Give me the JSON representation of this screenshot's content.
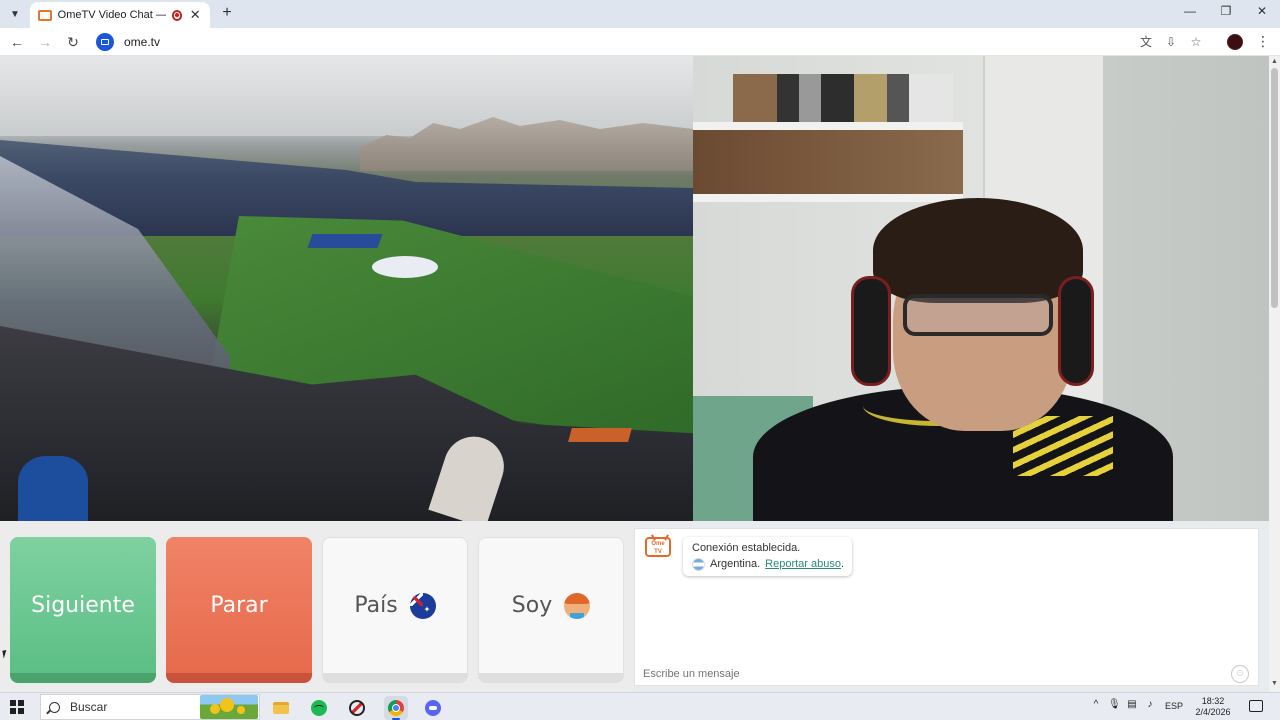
{
  "browser": {
    "tab": {
      "title": "OmeTV Video Chat — Ome",
      "close_glyph": "✕"
    },
    "new_tab_glyph": "+",
    "window_controls": {
      "minimize": "—",
      "maximize": "❐",
      "close": "✕"
    },
    "nav": {
      "back": "←",
      "forward": "→",
      "reload": "↻"
    },
    "url": "ome.tv",
    "toolbar_icons": [
      "translate-icon",
      "install-app-icon",
      "bookmark-star-icon",
      "profile-avatar",
      "menu-icon"
    ],
    "menu_glyph": "⋮"
  },
  "controls": {
    "next_label": "Siguiente",
    "stop_label": "Parar",
    "country_label": "País",
    "country_icon": "australia-flag-icon",
    "gender_label": "Soy",
    "gender_icon": "boy-avatar-icon",
    "colors": {
      "next": "#6cc994",
      "stop": "#ea765a"
    }
  },
  "chat": {
    "logo_text": "Ome TV",
    "system_message": "Conexión establecida.",
    "country_text": "Argentina.",
    "report_link": "Reportar abuso",
    "trailing_period": ".",
    "input_placeholder": "Escribe un mensaje",
    "emoji_glyph": "☺"
  },
  "taskbar": {
    "search_label": "Buscar",
    "tray": {
      "chevron": "^",
      "language": "ESP"
    },
    "time": "18:32",
    "date": "2/4/2026",
    "apps": [
      "file-explorer-icon",
      "spotify-icon",
      "vpn-icon",
      "chrome-icon",
      "discord-icon"
    ]
  }
}
